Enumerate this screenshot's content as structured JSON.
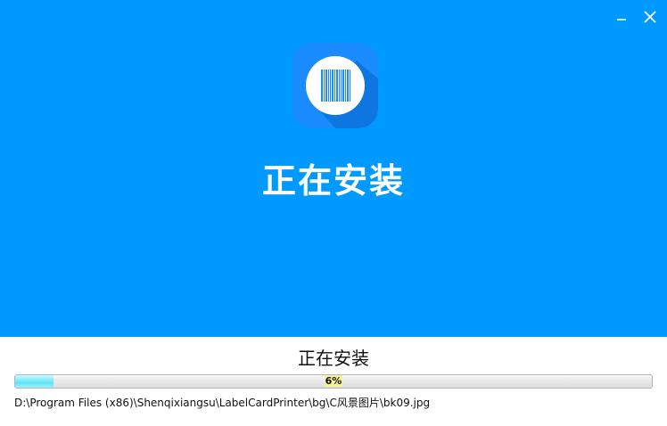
{
  "window": {
    "hero_title": "正在安装",
    "status_title": "正在安装",
    "controls": {
      "minimize_icon": "minimize-icon",
      "close_icon": "close-icon"
    }
  },
  "app_icon": "barcode-icon",
  "progress": {
    "percent": 6,
    "label": "6%"
  },
  "current_file": "D:\\Program Files (x86)\\Shenqixiangsu\\LabelCardPrinter\\bg\\C风景图片\\bk09.jpg",
  "colors": {
    "hero_bg": "#0099ff",
    "icon_bg": "#1a8cff",
    "progress_fill": "#5fe3f5"
  }
}
